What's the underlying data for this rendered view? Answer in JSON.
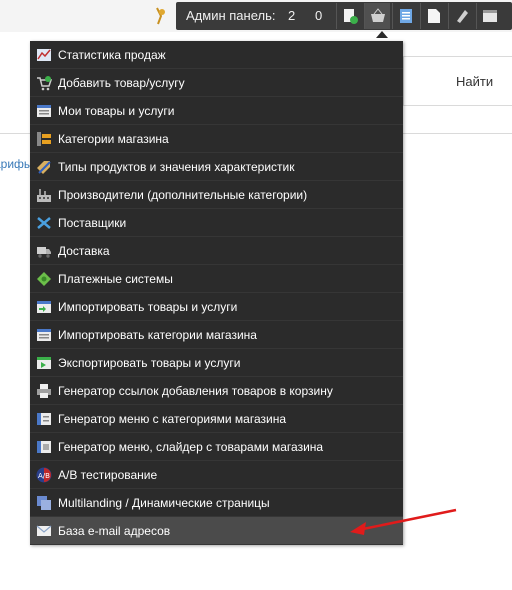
{
  "admin_bar": {
    "label": "Админ панель:",
    "count_a": "2",
    "count_b": "0",
    "buttons": [
      "add-page-icon",
      "basket-icon",
      "document-list-icon",
      "blank-page-icon",
      "edit-tool-icon",
      "settings-panel-icon"
    ]
  },
  "search": {
    "button_label": "Найти"
  },
  "side_link": "арифы",
  "menu": {
    "items": [
      {
        "label": "Статистика продаж",
        "icon": "stats-chart-icon"
      },
      {
        "label": "Добавить товар/услугу",
        "icon": "cart-add-icon"
      },
      {
        "label": "Мои товары и услуги",
        "icon": "product-list-icon"
      },
      {
        "label": "Категории магазина",
        "icon": "category-folder-icon"
      },
      {
        "label": "Типы продуктов и значения характеристик",
        "icon": "tag-edit-icon"
      },
      {
        "label": "Производители (дополнительные категории)",
        "icon": "factory-icon"
      },
      {
        "label": "Поставщики",
        "icon": "suppliers-icon"
      },
      {
        "label": "Доставка",
        "icon": "truck-icon"
      },
      {
        "label": "Платежные системы",
        "icon": "money-icon"
      },
      {
        "label": "Импортировать товары и услуги",
        "icon": "import-products-icon"
      },
      {
        "label": "Импортировать категории магазина",
        "icon": "import-categories-icon"
      },
      {
        "label": "Экспортировать товары и услуги",
        "icon": "export-products-icon"
      },
      {
        "label": "Генератор ссылок добавления товаров в корзину",
        "icon": "printer-icon"
      },
      {
        "label": "Генератор меню с категориями магазина",
        "icon": "menu-generator-icon"
      },
      {
        "label": "Генератор меню, слайдер с товарами магазина",
        "icon": "slider-generator-icon"
      },
      {
        "label": "A/B тестирование",
        "icon": "ab-test-icon"
      },
      {
        "label": "Multilanding / Динамические страницы",
        "icon": "multilanding-icon"
      },
      {
        "label": "База e-mail адресов",
        "icon": "envelope-icon"
      }
    ]
  },
  "colors": {
    "menu_bg": "#2b2b2b",
    "menu_hover": "#4b4b4b",
    "arrow": "#e01b1b",
    "link": "#3a7ab8"
  }
}
